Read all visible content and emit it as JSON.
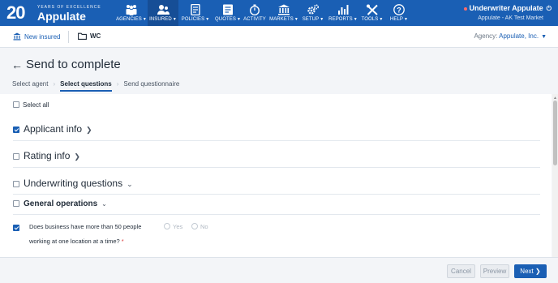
{
  "brand": {
    "years": "20",
    "tagline": "YEARS OF EXCELLENCE",
    "name": "Appulate"
  },
  "nav": {
    "items": [
      {
        "label": "AGENCIES",
        "icon": "agencies-icon"
      },
      {
        "label": "INSURED",
        "icon": "insured-icon",
        "active": true
      },
      {
        "label": "POLICIES",
        "icon": "policies-icon"
      },
      {
        "label": "QUOTES",
        "icon": "quotes-icon"
      },
      {
        "label": "ACTIVITY",
        "icon": "activity-icon"
      },
      {
        "label": "MARKETS",
        "icon": "markets-icon"
      },
      {
        "label": "SETUP",
        "icon": "setup-icon"
      },
      {
        "label": "REPORTS",
        "icon": "reports-icon"
      },
      {
        "label": "TOOLS",
        "icon": "tools-icon"
      },
      {
        "label": "HELP",
        "icon": "help-icon"
      }
    ]
  },
  "user": {
    "name": "Underwriter Appulate",
    "subtitle": "Appulate - AK Test Market"
  },
  "subbar": {
    "new_insured": "New insured",
    "policy": "WC",
    "agency_label": "Agency:",
    "agency_value": "Appulate, Inc."
  },
  "page": {
    "title": "Send to complete",
    "steps": [
      "Select agent",
      "Select questions",
      "Send questionnaire"
    ],
    "active_step": 1
  },
  "content": {
    "select_all": "Select all",
    "sections": [
      {
        "label": "Applicant info",
        "checked": true
      },
      {
        "label": "Rating info",
        "checked": false
      },
      {
        "label": "Underwriting questions",
        "checked": false
      }
    ],
    "subsection": {
      "label": "General operations",
      "checked": false
    },
    "question": {
      "line1": "Does business have more than 50 people",
      "line2": "working at one location at a time?",
      "required_mark": "*",
      "checked": true,
      "options": [
        "Yes",
        "No"
      ]
    }
  },
  "footer": {
    "cancel": "Cancel",
    "preview": "Preview",
    "next": "Next"
  },
  "colors": {
    "primary": "#1a5fb4",
    "required": "#d93a3a"
  }
}
